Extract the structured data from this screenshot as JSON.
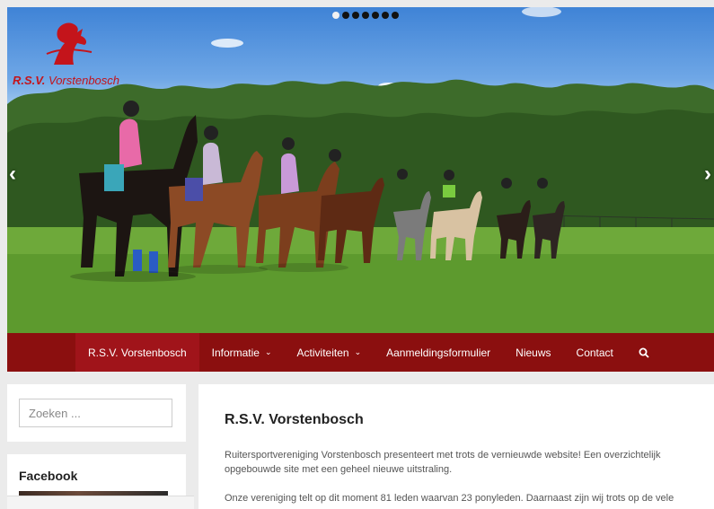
{
  "slider": {
    "dot_count": 7,
    "active_index": 0,
    "prev_arrow": "‹",
    "next_arrow": "›"
  },
  "logo": {
    "brand_prefix": "R.S.V.",
    "brand_name": "Vorstenbosch",
    "color": "#c4141b"
  },
  "nav": {
    "items": [
      {
        "label": "R.S.V. Vorstenbosch",
        "active": true,
        "has_dropdown": false
      },
      {
        "label": "Informatie",
        "active": false,
        "has_dropdown": true
      },
      {
        "label": "Activiteiten",
        "active": false,
        "has_dropdown": true
      },
      {
        "label": "Aanmeldingsformulier",
        "active": false,
        "has_dropdown": false
      },
      {
        "label": "Nieuws",
        "active": false,
        "has_dropdown": false
      },
      {
        "label": "Contact",
        "active": false,
        "has_dropdown": false
      }
    ],
    "search_icon": "search-icon",
    "background": "#8b0f0f",
    "active_background": "#a0141a"
  },
  "sidebar": {
    "search_placeholder": "Zoeken ...",
    "facebook_title": "Facebook"
  },
  "main": {
    "title": "R.S.V. Vorstenbosch",
    "paragraph1": "Ruitersportvereniging Vorstenbosch presenteert met trots de vernieuwde website! Een overzichtelijk opgebouwde site met een geheel nieuwe uitstraling.",
    "paragraph2": "Onze vereniging telt op dit moment 81 leden waarvan 23 ponyleden. Daarnaast zijn wij trots op de vele"
  }
}
